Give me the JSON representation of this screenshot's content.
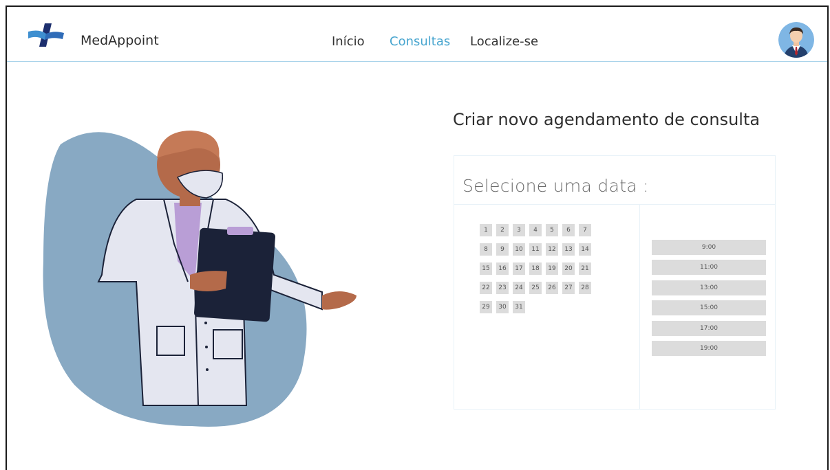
{
  "header": {
    "brand": "MedAppoint",
    "nav": [
      {
        "label": "Início",
        "active": false
      },
      {
        "label": "Consultas",
        "active": true
      },
      {
        "label": "Localize-se",
        "active": false
      }
    ],
    "logo_icon": "medical-cross-logo",
    "avatar_icon": "user-avatar-icon"
  },
  "colors": {
    "accent": "#47a5cf",
    "header_border": "#a9d3ea",
    "blob": "#88a9c3",
    "coat": "#e4e6f0",
    "clipboard": "#1b2238",
    "cell": "#dcdcdc"
  },
  "form": {
    "title": "Criar novo agendamento de consulta",
    "date_prompt": "Selecione uma data :",
    "days": [
      "1",
      "2",
      "3",
      "4",
      "5",
      "6",
      "7",
      "8",
      "9",
      "10",
      "11",
      "12",
      "13",
      "14",
      "15",
      "16",
      "17",
      "18",
      "19",
      "20",
      "21",
      "22",
      "23",
      "24",
      "25",
      "26",
      "27",
      "28",
      "29",
      "30",
      "31"
    ],
    "times": [
      "9:00",
      "11:00",
      "13:00",
      "15:00",
      "17:00",
      "19:00"
    ]
  }
}
